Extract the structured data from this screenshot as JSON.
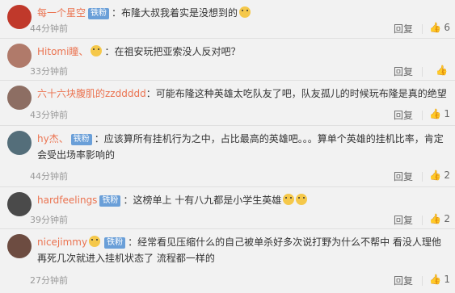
{
  "comments": [
    {
      "user": "每一个星空",
      "badge": "铁粉",
      "text": "：布隆大叔我着实是没想到的",
      "emoji": "dog-emoji",
      "time": "44分钟前",
      "reply": "回复",
      "likes": "6",
      "avatar_color": "#c0392b"
    },
    {
      "user": "Hitomi瞳、",
      "badge": "",
      "text": "：在祖安玩把亚索没人反对吧？",
      "emoji": "",
      "time": "33分钟前",
      "reply": "回复",
      "likes": "",
      "avatar_color": "#b07a6a"
    },
    {
      "user": "六十六块腹肌的zzddddd",
      "badge": "",
      "text": "：可能布隆这种英雄太吃队友了吧，队友孤儿的时候玩布隆是真的绝望",
      "emoji": "",
      "time": "43分钟前",
      "reply": "回复",
      "likes": "1",
      "avatar_color": "#8d6e63"
    },
    {
      "user": "hy杰、",
      "badge": "铁粉",
      "text": "：应该算所有挂机行为之中，占比最高的英雄吧。。。算单个英雄的挂机比率，肯定会受出场率影响的",
      "emoji": "",
      "time": "44分钟前",
      "reply": "回复",
      "likes": "2",
      "avatar_color": "#546e7a"
    },
    {
      "user": "hardfeelings",
      "badge": "铁粉",
      "text": "：这榜单上 十有八九都是小学生英雄",
      "emoji": "grin-emoji",
      "time": "39分钟前",
      "reply": "回复",
      "likes": "2",
      "avatar_color": "#4a4a4a"
    },
    {
      "user": "nicejimmy",
      "badge": "铁粉",
      "text": "：经常看见压缩什么的自己被单杀好多次说打野为什么不帮中 看没人理他再死几次就进入挂机状态了 流程都一样的",
      "emoji": "",
      "time": "27分钟前",
      "reply": "回复",
      "likes": "1",
      "avatar_color": "#6d4c41"
    }
  ]
}
